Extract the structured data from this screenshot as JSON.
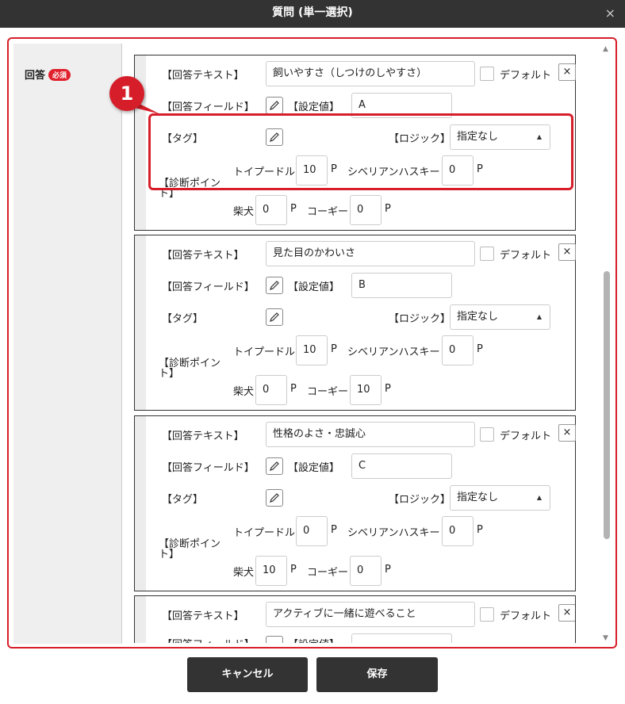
{
  "title": "質問 (単一選択)",
  "close_label": "×",
  "field_label": "回答",
  "required_badge": "必須",
  "callout_number": "1",
  "labels": {
    "answer_text": "【回答テキスト】",
    "answer_field": "【回答フィールド】",
    "setting_value": "【設定値】",
    "tag": "【タグ】",
    "logic": "【ロジック】",
    "diagnosis_line1": "【診断ポイン",
    "diagnosis_line2": "ト】",
    "default": "デフォルト",
    "point_unit": "P"
  },
  "dog_names": {
    "poodle": "トイプードル",
    "husky": "シベリアンハスキー",
    "shiba": "柴犬",
    "corgi": "コーギー"
  },
  "answers": [
    {
      "text": "飼いやすさ（しつけのしやすさ）",
      "value": "A",
      "logic": "指定なし",
      "points": {
        "poodle": "10",
        "husky": "0",
        "shiba": "0",
        "corgi": "0"
      }
    },
    {
      "text": "見た目のかわいさ",
      "value": "B",
      "logic": "指定なし",
      "points": {
        "poodle": "10",
        "husky": "0",
        "shiba": "0",
        "corgi": "10"
      }
    },
    {
      "text": "性格のよさ・忠誠心",
      "value": "C",
      "logic": "指定なし",
      "points": {
        "poodle": "0",
        "husky": "0",
        "shiba": "10",
        "corgi": "0"
      }
    },
    {
      "text": "アクティブに一緒に遊べること"
    }
  ],
  "buttons": {
    "cancel": "キャンセル",
    "save": "保存"
  },
  "colors": {
    "accent_red": "#d61e2a",
    "title_bar": "#333333",
    "footer_button": "#333333"
  }
}
